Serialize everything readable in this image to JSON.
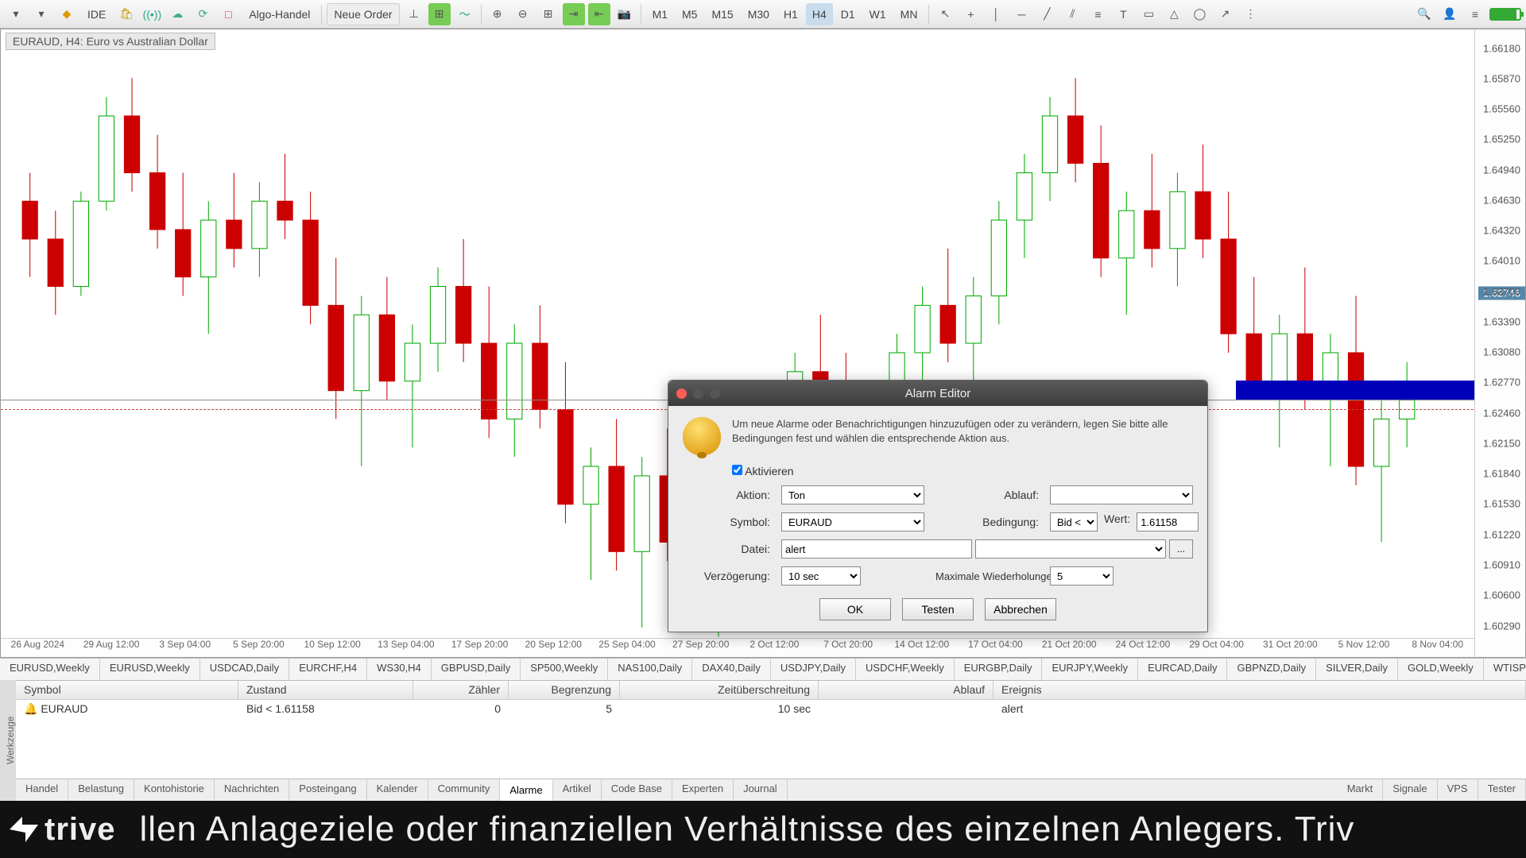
{
  "toolbar": {
    "ide_label": "IDE",
    "algo_label": "Algo-Handel",
    "neworder_label": "Neue Order",
    "timeframes": [
      "M1",
      "M5",
      "M15",
      "M30",
      "H1",
      "H4",
      "D1",
      "W1",
      "MN"
    ],
    "active_tf": "H4"
  },
  "chart": {
    "title": "EURAUD, H4: Euro vs Australian Dollar",
    "y_ticks": [
      "1.66180",
      "1.65870",
      "1.65560",
      "1.65250",
      "1.64940",
      "1.64630",
      "1.64320",
      "1.64010",
      "1.63700",
      "1.63390",
      "1.63080",
      "1.62770",
      "1.62460",
      "1.62150",
      "1.61840",
      "1.61530",
      "1.61220",
      "1.60910",
      "1.60600",
      "1.60290"
    ],
    "current_price": "1.62746",
    "x_ticks": [
      "26 Aug 2024",
      "29 Aug 12:00",
      "3 Sep 04:00",
      "5 Sep 20:00",
      "10 Sep 12:00",
      "13 Sep 04:00",
      "17 Sep 20:00",
      "20 Sep 12:00",
      "25 Sep 04:00",
      "27 Sep 20:00",
      "2 Oct 12:00",
      "7 Oct 20:00",
      "14 Oct 12:00",
      "17 Oct 04:00",
      "21 Oct 20:00",
      "24 Oct 12:00",
      "29 Oct 04:00",
      "31 Oct 20:00",
      "5 Nov 12:00",
      "8 Nov 04:00"
    ]
  },
  "dialog": {
    "title": "Alarm Editor",
    "info": "Um neue Alarme oder Benachrichtigungen hinzuzufügen oder zu verändern, legen Sie bitte alle Bedingungen fest und wählen die entsprechende Aktion aus.",
    "activate_label": "Aktivieren",
    "aktion_label": "Aktion:",
    "aktion_value": "Ton",
    "ablauf_label": "Ablauf:",
    "ablauf_value": "",
    "symbol_label": "Symbol:",
    "symbol_value": "EURAUD",
    "bedingung_label": "Bedingung:",
    "bedingung_value": "Bid <",
    "wert_label": "Wert:",
    "wert_value": "1.61158",
    "datei_label": "Datei:",
    "datei_value": "alert",
    "verzogerung_label": "Verzögerung:",
    "verzogerung_value": "10 sec",
    "maxwdh_label": "Maximale Wiederholungen:",
    "maxwdh_value": "5",
    "ok": "OK",
    "testen": "Testen",
    "abbrechen": "Abbrechen"
  },
  "chart_tabs": [
    "EURUSD,Weekly",
    "EURUSD,Weekly",
    "USDCAD,Daily",
    "EURCHF,H4",
    "WS30,H4",
    "GBPUSD,Daily",
    "SP500,Weekly",
    "NAS100,Daily",
    "DAX40,Daily",
    "USDJPY,Daily",
    "USDCHF,Weekly",
    "EURGBP,Daily",
    "EURJPY,Weekly",
    "EURCAD,Daily",
    "GBPNZD,Daily",
    "SILVER,Daily",
    "GOLD,Weekly",
    "WTISPOT,Daily"
  ],
  "alerts": {
    "side_label": "Werkzeuge",
    "headers": {
      "symbol": "Symbol",
      "zustand": "Zustand",
      "zahler": "Zähler",
      "begrenzung": "Begrenzung",
      "zeitueberschreitung": "Zeitüberschreitung",
      "ablauf": "Ablauf",
      "ereignis": "Ereignis"
    },
    "row": {
      "symbol": "EURAUD",
      "zustand": "Bid < 1.61158",
      "zahler": "0",
      "begrenzung": "5",
      "zeitueberschreitung": "10 sec",
      "ablauf": "",
      "ereignis": "alert"
    }
  },
  "panel_tabs": {
    "left": [
      "Handel",
      "Belastung",
      "Kontohistorie",
      "Nachrichten",
      "Posteingang",
      "Kalender",
      "Community",
      "Alarme",
      "Artikel",
      "Code Base",
      "Experten",
      "Journal"
    ],
    "active": "Alarme",
    "right": [
      "Markt",
      "Signale",
      "VPS",
      "Tester"
    ]
  },
  "footer": {
    "brand": "trive",
    "text": "llen Anlageziele oder finanziellen Verhältnisse des einzelnen Anlegers. Triv"
  },
  "chart_data": {
    "type": "candlestick",
    "note": "approximate OHLC read from pixels",
    "x_range": [
      "2024-08-26",
      "2024-11-08"
    ],
    "y_range": [
      1.6029,
      1.6618
    ],
    "candles": [
      {
        "t": "08-26",
        "o": 1.648,
        "h": 1.651,
        "l": 1.64,
        "c": 1.644
      },
      {
        "t": "08-27",
        "o": 1.644,
        "h": 1.647,
        "l": 1.636,
        "c": 1.639
      },
      {
        "t": "08-28",
        "o": 1.639,
        "h": 1.649,
        "l": 1.638,
        "c": 1.648
      },
      {
        "t": "08-29",
        "o": 1.648,
        "h": 1.659,
        "l": 1.647,
        "c": 1.657
      },
      {
        "t": "08-30",
        "o": 1.657,
        "h": 1.661,
        "l": 1.649,
        "c": 1.651
      },
      {
        "t": "09-02",
        "o": 1.651,
        "h": 1.655,
        "l": 1.643,
        "c": 1.645
      },
      {
        "t": "09-03",
        "o": 1.645,
        "h": 1.651,
        "l": 1.638,
        "c": 1.64
      },
      {
        "t": "09-04",
        "o": 1.64,
        "h": 1.648,
        "l": 1.634,
        "c": 1.646
      },
      {
        "t": "09-05",
        "o": 1.646,
        "h": 1.651,
        "l": 1.641,
        "c": 1.643
      },
      {
        "t": "09-06",
        "o": 1.643,
        "h": 1.65,
        "l": 1.64,
        "c": 1.648
      },
      {
        "t": "09-09",
        "o": 1.648,
        "h": 1.653,
        "l": 1.644,
        "c": 1.646
      },
      {
        "t": "09-10",
        "o": 1.646,
        "h": 1.649,
        "l": 1.635,
        "c": 1.637
      },
      {
        "t": "09-11",
        "o": 1.637,
        "h": 1.642,
        "l": 1.625,
        "c": 1.628
      },
      {
        "t": "09-12",
        "o": 1.628,
        "h": 1.638,
        "l": 1.62,
        "c": 1.636
      },
      {
        "t": "09-13",
        "o": 1.636,
        "h": 1.64,
        "l": 1.627,
        "c": 1.629
      },
      {
        "t": "09-16",
        "o": 1.629,
        "h": 1.635,
        "l": 1.622,
        "c": 1.633
      },
      {
        "t": "09-17",
        "o": 1.633,
        "h": 1.641,
        "l": 1.63,
        "c": 1.639
      },
      {
        "t": "09-18",
        "o": 1.639,
        "h": 1.644,
        "l": 1.631,
        "c": 1.633
      },
      {
        "t": "09-19",
        "o": 1.633,
        "h": 1.639,
        "l": 1.623,
        "c": 1.625
      },
      {
        "t": "09-20",
        "o": 1.625,
        "h": 1.635,
        "l": 1.621,
        "c": 1.633
      },
      {
        "t": "09-23",
        "o": 1.633,
        "h": 1.637,
        "l": 1.624,
        "c": 1.626
      },
      {
        "t": "09-24",
        "o": 1.626,
        "h": 1.631,
        "l": 1.614,
        "c": 1.616
      },
      {
        "t": "09-25",
        "o": 1.616,
        "h": 1.622,
        "l": 1.608,
        "c": 1.62
      },
      {
        "t": "09-26",
        "o": 1.62,
        "h": 1.625,
        "l": 1.609,
        "c": 1.611
      },
      {
        "t": "09-27",
        "o": 1.611,
        "h": 1.621,
        "l": 1.603,
        "c": 1.619
      },
      {
        "t": "09-30",
        "o": 1.619,
        "h": 1.624,
        "l": 1.61,
        "c": 1.612
      },
      {
        "t": "10-01",
        "o": 1.612,
        "h": 1.618,
        "l": 1.605,
        "c": 1.606
      },
      {
        "t": "10-02",
        "o": 1.606,
        "h": 1.617,
        "l": 1.602,
        "c": 1.615
      },
      {
        "t": "10-03",
        "o": 1.615,
        "h": 1.622,
        "l": 1.611,
        "c": 1.62
      },
      {
        "t": "10-04",
        "o": 1.62,
        "h": 1.627,
        "l": 1.616,
        "c": 1.625
      },
      {
        "t": "10-07",
        "o": 1.625,
        "h": 1.632,
        "l": 1.621,
        "c": 1.63
      },
      {
        "t": "10-08",
        "o": 1.63,
        "h": 1.636,
        "l": 1.624,
        "c": 1.626
      },
      {
        "t": "10-09",
        "o": 1.626,
        "h": 1.632,
        "l": 1.62,
        "c": 1.622
      },
      {
        "t": "10-10",
        "o": 1.622,
        "h": 1.628,
        "l": 1.617,
        "c": 1.626
      },
      {
        "t": "10-11",
        "o": 1.626,
        "h": 1.634,
        "l": 1.622,
        "c": 1.632
      },
      {
        "t": "10-14",
        "o": 1.632,
        "h": 1.639,
        "l": 1.628,
        "c": 1.637
      },
      {
        "t": "10-15",
        "o": 1.637,
        "h": 1.643,
        "l": 1.631,
        "c": 1.633
      },
      {
        "t": "10-16",
        "o": 1.633,
        "h": 1.64,
        "l": 1.628,
        "c": 1.638
      },
      {
        "t": "10-17",
        "o": 1.638,
        "h": 1.648,
        "l": 1.635,
        "c": 1.646
      },
      {
        "t": "10-18",
        "o": 1.646,
        "h": 1.653,
        "l": 1.642,
        "c": 1.651
      },
      {
        "t": "10-21",
        "o": 1.651,
        "h": 1.659,
        "l": 1.648,
        "c": 1.657
      },
      {
        "t": "10-22",
        "o": 1.657,
        "h": 1.661,
        "l": 1.65,
        "c": 1.652
      },
      {
        "t": "10-23",
        "o": 1.652,
        "h": 1.656,
        "l": 1.64,
        "c": 1.642
      },
      {
        "t": "10-24",
        "o": 1.642,
        "h": 1.649,
        "l": 1.636,
        "c": 1.647
      },
      {
        "t": "10-25",
        "o": 1.647,
        "h": 1.653,
        "l": 1.641,
        "c": 1.643
      },
      {
        "t": "10-28",
        "o": 1.643,
        "h": 1.651,
        "l": 1.639,
        "c": 1.649
      },
      {
        "t": "10-29",
        "o": 1.649,
        "h": 1.654,
        "l": 1.642,
        "c": 1.644
      },
      {
        "t": "10-30",
        "o": 1.644,
        "h": 1.649,
        "l": 1.632,
        "c": 1.634
      },
      {
        "t": "10-31",
        "o": 1.634,
        "h": 1.64,
        "l": 1.627,
        "c": 1.629
      },
      {
        "t": "11-01",
        "o": 1.629,
        "h": 1.636,
        "l": 1.622,
        "c": 1.634
      },
      {
        "t": "11-04",
        "o": 1.634,
        "h": 1.641,
        "l": 1.626,
        "c": 1.628
      },
      {
        "t": "11-05",
        "o": 1.628,
        "h": 1.634,
        "l": 1.62,
        "c": 1.632
      },
      {
        "t": "11-06",
        "o": 1.632,
        "h": 1.638,
        "l": 1.618,
        "c": 1.62
      },
      {
        "t": "11-07",
        "o": 1.62,
        "h": 1.627,
        "l": 1.612,
        "c": 1.625
      },
      {
        "t": "11-08",
        "o": 1.625,
        "h": 1.631,
        "l": 1.622,
        "c": 1.627
      }
    ]
  }
}
